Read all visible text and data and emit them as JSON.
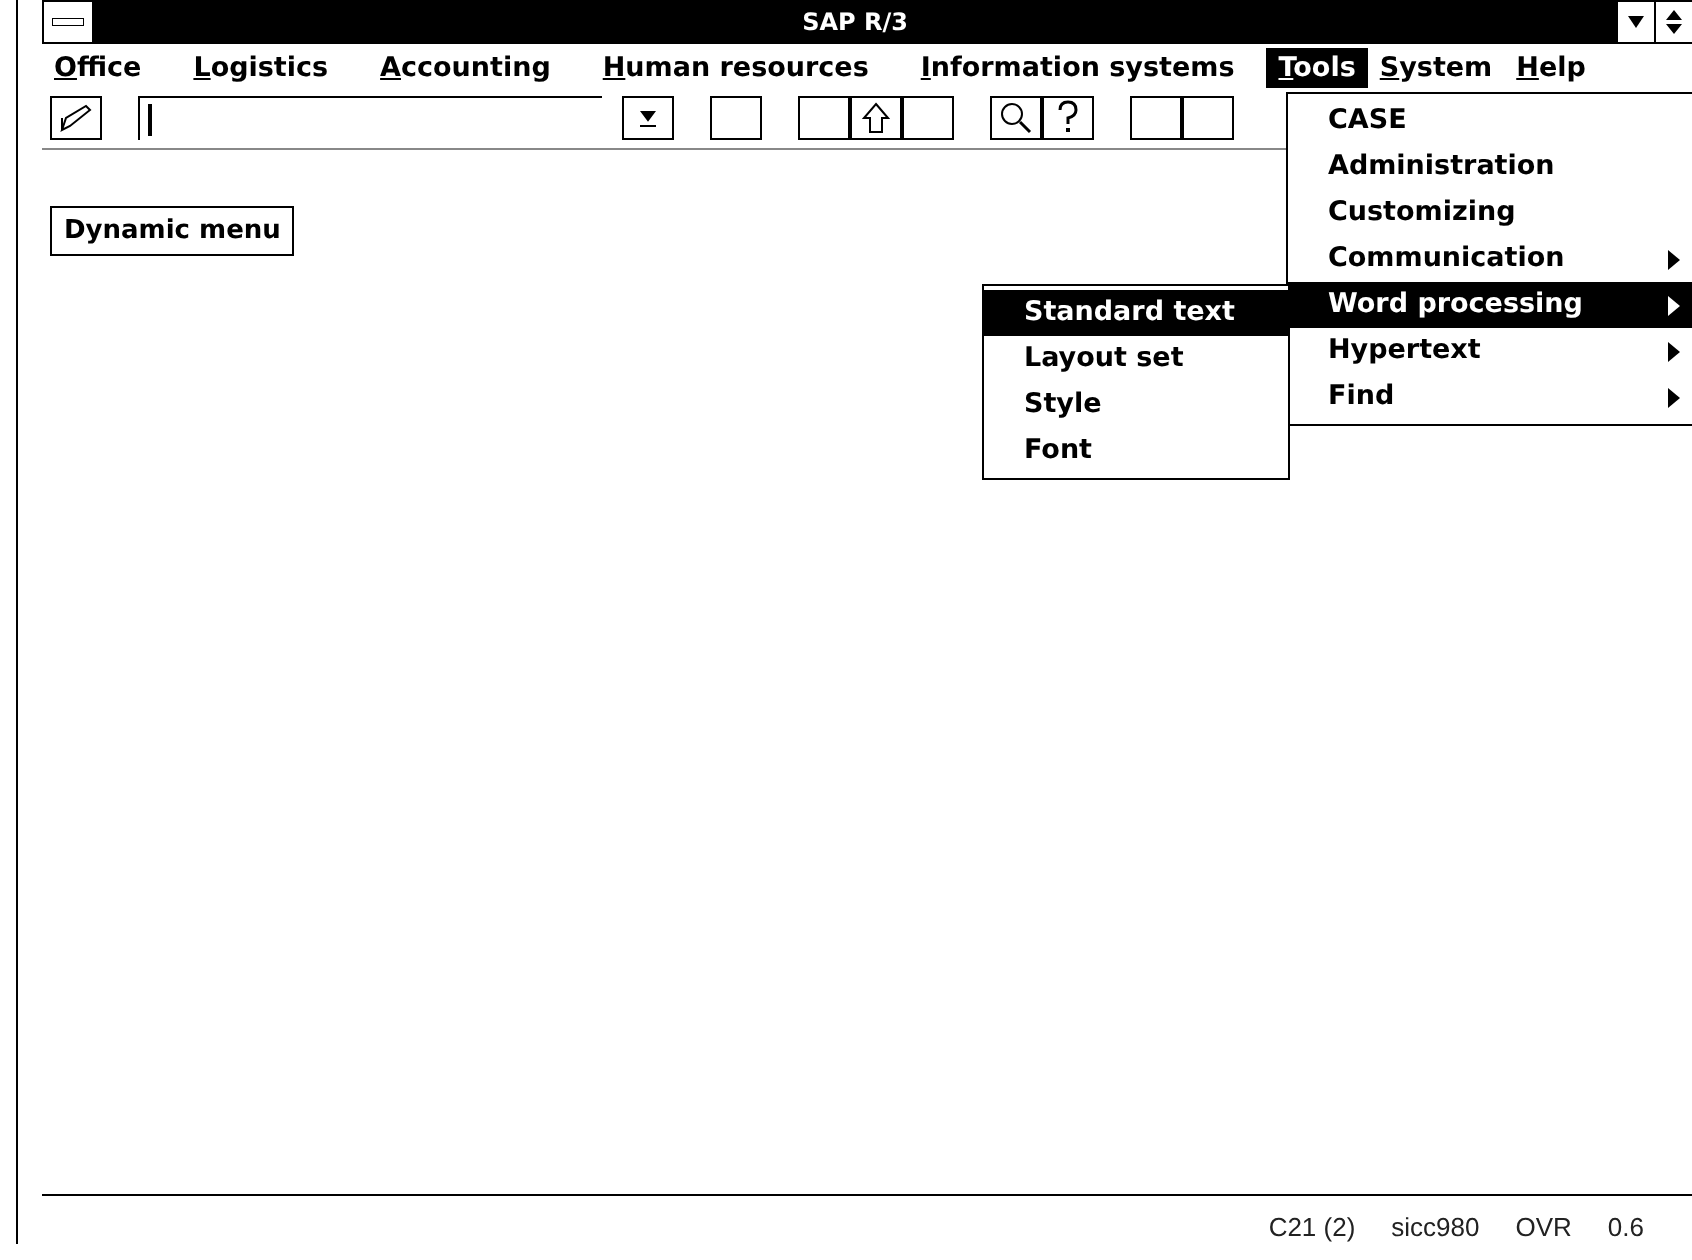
{
  "window": {
    "title": "SAP R/3"
  },
  "menu_bar": [
    {
      "label": "Office",
      "selected": false
    },
    {
      "label": "Logistics",
      "selected": false
    },
    {
      "label": "Accounting",
      "selected": false
    },
    {
      "label": "Human resources",
      "selected": false
    },
    {
      "label": "Information systems",
      "selected": false
    },
    {
      "label": "Tools",
      "selected": true
    },
    {
      "label": "System",
      "selected": false
    },
    {
      "label": "Help",
      "selected": false
    }
  ],
  "toolbar": [
    {
      "kind": "check"
    },
    {
      "kind": "command"
    },
    {
      "kind": "down"
    },
    {
      "kind": "gap"
    },
    {
      "kind": "empty"
    },
    {
      "kind": "gap"
    },
    {
      "kind": "empty"
    },
    {
      "kind": "up"
    },
    {
      "kind": "empty"
    },
    {
      "kind": "gap"
    },
    {
      "kind": "search"
    },
    {
      "kind": "help"
    },
    {
      "kind": "gap"
    },
    {
      "kind": "empty"
    },
    {
      "kind": "empty"
    }
  ],
  "dynamic_menu_button": "Dynamic menu",
  "tools_menu": [
    {
      "label": "CASE",
      "submenu": false,
      "selected": false
    },
    {
      "label": "Administration",
      "submenu": false,
      "selected": false
    },
    {
      "label": "Customizing",
      "submenu": false,
      "selected": false
    },
    {
      "label": "Communication",
      "submenu": true,
      "selected": false
    },
    {
      "label": "Word processing",
      "submenu": true,
      "selected": true
    },
    {
      "label": "Hypertext",
      "submenu": true,
      "selected": false
    },
    {
      "label": "Find",
      "submenu": true,
      "selected": false
    }
  ],
  "word_processing_menu": [
    {
      "label": "Standard text",
      "selected": true
    },
    {
      "label": "Layout set",
      "selected": false
    },
    {
      "label": "Style",
      "selected": false
    },
    {
      "label": "Font",
      "selected": false
    }
  ],
  "status_bar": [
    "C21 (2)",
    "sicc980",
    "OVR",
    "0.6"
  ]
}
